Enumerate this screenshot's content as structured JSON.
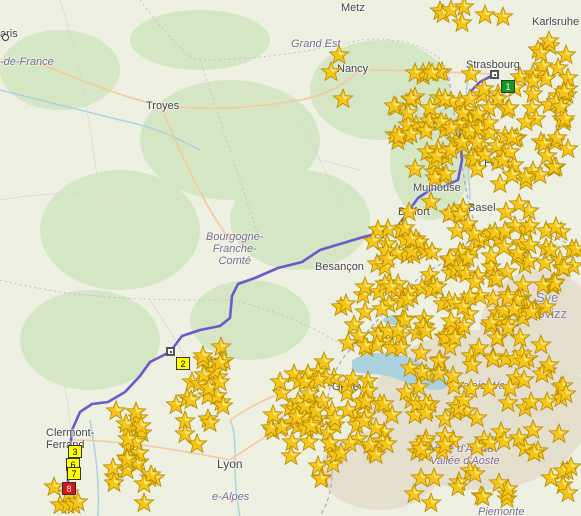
{
  "map": {
    "places": [
      {
        "id": "metz",
        "name": "Metz"
      },
      {
        "id": "karlsruhe",
        "name": "Karlsruhe"
      },
      {
        "id": "paris",
        "name": "aris"
      },
      {
        "id": "ile",
        "name": "-de-France"
      },
      {
        "id": "nancy",
        "name": "Nancy"
      },
      {
        "id": "strasbourg",
        "name": "Strasbourg"
      },
      {
        "id": "troyes",
        "name": "Troyes"
      },
      {
        "id": "freiburg",
        "name": "Frei"
      },
      {
        "id": "belfort",
        "name": "Belfort"
      },
      {
        "id": "basel",
        "name": "Basel"
      },
      {
        "id": "besancon",
        "name": "Besançon"
      },
      {
        "id": "clermont",
        "name": "Clermont-Ferrand"
      },
      {
        "id": "lyon",
        "name": "Lyon"
      },
      {
        "id": "geneve",
        "name": "Genève"
      },
      {
        "id": "mulhouse",
        "name": "Mulhouse"
      }
    ],
    "regions": [
      {
        "id": "grand-est",
        "name": "Grand Est"
      },
      {
        "id": "bfc",
        "name": "Bourgogne-\nFranche-\nComté"
      },
      {
        "id": "ara",
        "name": "e-Alpes"
      },
      {
        "id": "aosta",
        "name": "Valle d'Aosta /\nVallée d'Aoste"
      },
      {
        "id": "valais",
        "name": "Valais/Wa"
      },
      {
        "id": "piemonte",
        "name": "Piemonte"
      }
    ],
    "country": {
      "name": "Schweiz/Suisse/Svizzera",
      "visible": "Sve\nSvizz"
    },
    "markers": [
      {
        "label": "1",
        "color": "green"
      },
      {
        "label": "2",
        "color": "yellow"
      },
      {
        "label": "3",
        "color": "yellow"
      },
      {
        "label": "6",
        "color": "yellow"
      },
      {
        "label": "7",
        "color": "yellow"
      },
      {
        "label": "8",
        "color": "red"
      }
    ],
    "route_color": "#6a5acd",
    "star_color": "#f5c518"
  }
}
